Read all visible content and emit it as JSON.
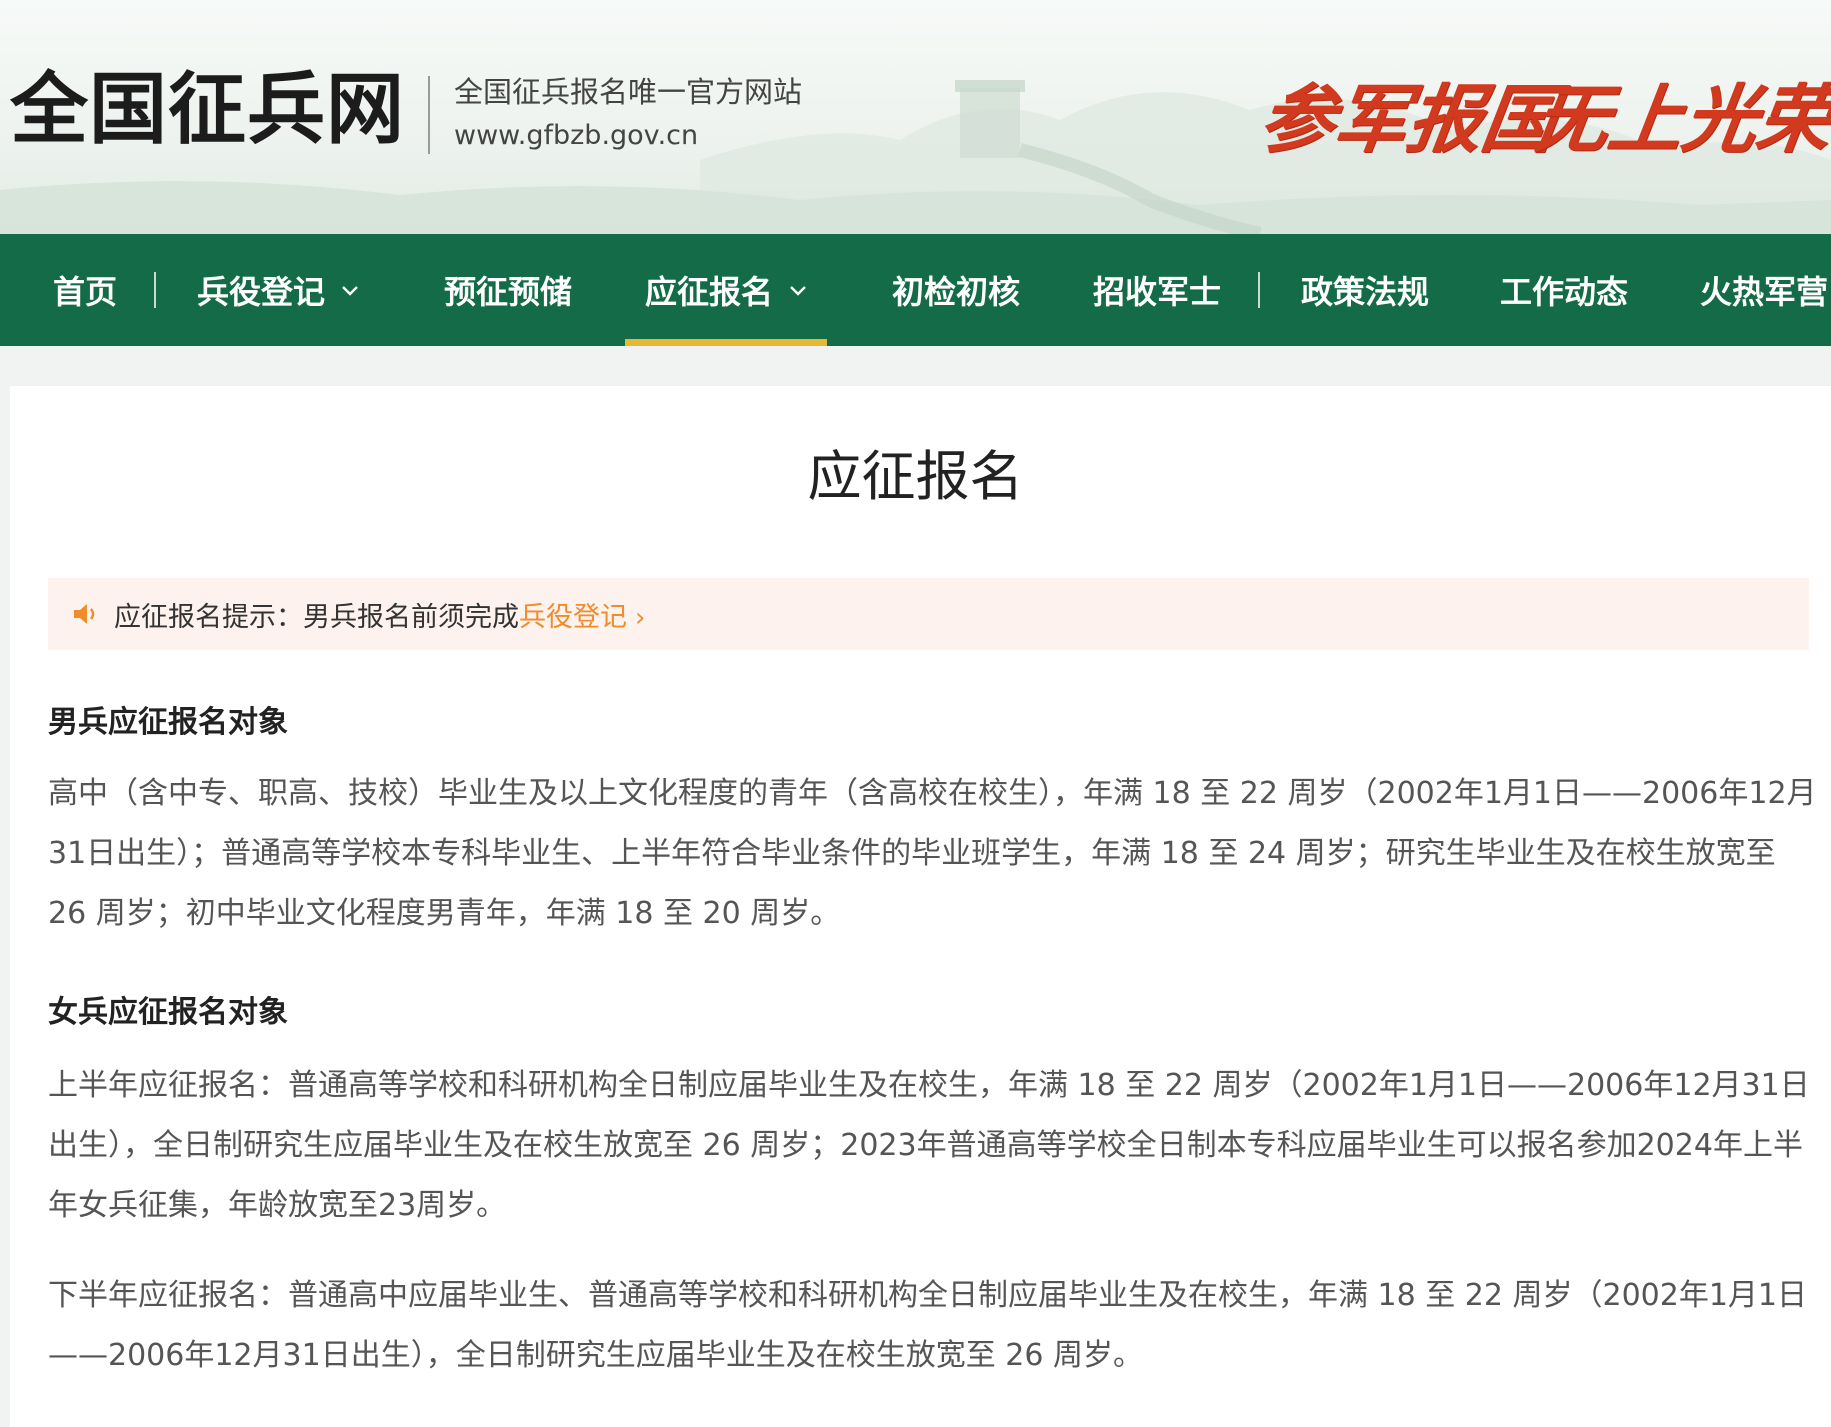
{
  "header": {
    "site_title": "全国征兵网",
    "tagline": "全国征兵报名唯一官方网站",
    "url": "www.gfbzb.gov.cn",
    "slogan_1": "参军报国",
    "slogan_2": "无上光荣"
  },
  "nav": {
    "items": [
      {
        "label": "首页"
      },
      {
        "label": "兵役登记"
      },
      {
        "label": "预征预储"
      },
      {
        "label": "应征报名"
      },
      {
        "label": "初检初核"
      },
      {
        "label": "招收军士"
      },
      {
        "label": "政策法规"
      },
      {
        "label": "工作动态"
      },
      {
        "label": "火热军营"
      }
    ],
    "active": "应征报名"
  },
  "main": {
    "title": "应征报名",
    "notice": {
      "prefix": "应征报名提示：男兵报名前须完成",
      "link": "兵役登记"
    },
    "male_heading": "男兵应征报名对象",
    "male_text": "高中（含中专、职高、技校）毕业生及以上文化程度的青年（含高校在校生），年满 18 至 22 周岁（2002年1月1日——2006年12月31日出生）；普通高等学校本专科毕业生、上半年符合毕业条件的毕业班学生，年满 18 至 24 周岁；研究生毕业生及在校生放宽至 26 周岁；初中毕业文化程度男青年，年满 18 至 20 周岁。",
    "female_heading": "女兵应征报名对象",
    "female_text_1": "上半年应征报名：普通高等学校和科研机构全日制应届毕业生及在校生，年满 18 至 22 周岁（2002年1月1日——2006年12月31日出生），全日制研究生应届毕业生及在校生放宽至 26 周岁；2023年普通高等学校全日制本专科应届毕业生可以报名参加2024年上半年女兵征集，年龄放宽至23周岁。",
    "female_text_2": "下半年应征报名：普通高中应届毕业生、普通高等学校和科研机构全日制应届毕业生及在校生，年满 18 至 22 周岁（2002年1月1日——2006年12月31日出生），全日制研究生应届毕业生及在校生放宽至 26 周岁。"
  },
  "colors": {
    "nav_bg": "#136b47",
    "nav_active_underline": "#e7b836",
    "slogan": "#d23a1f",
    "notice_bg": "#fdf2ed",
    "notice_link": "#f08c2a"
  },
  "icons": [
    "speaker-icon",
    "chevron-down-icon",
    "chevron-right-icon"
  ]
}
